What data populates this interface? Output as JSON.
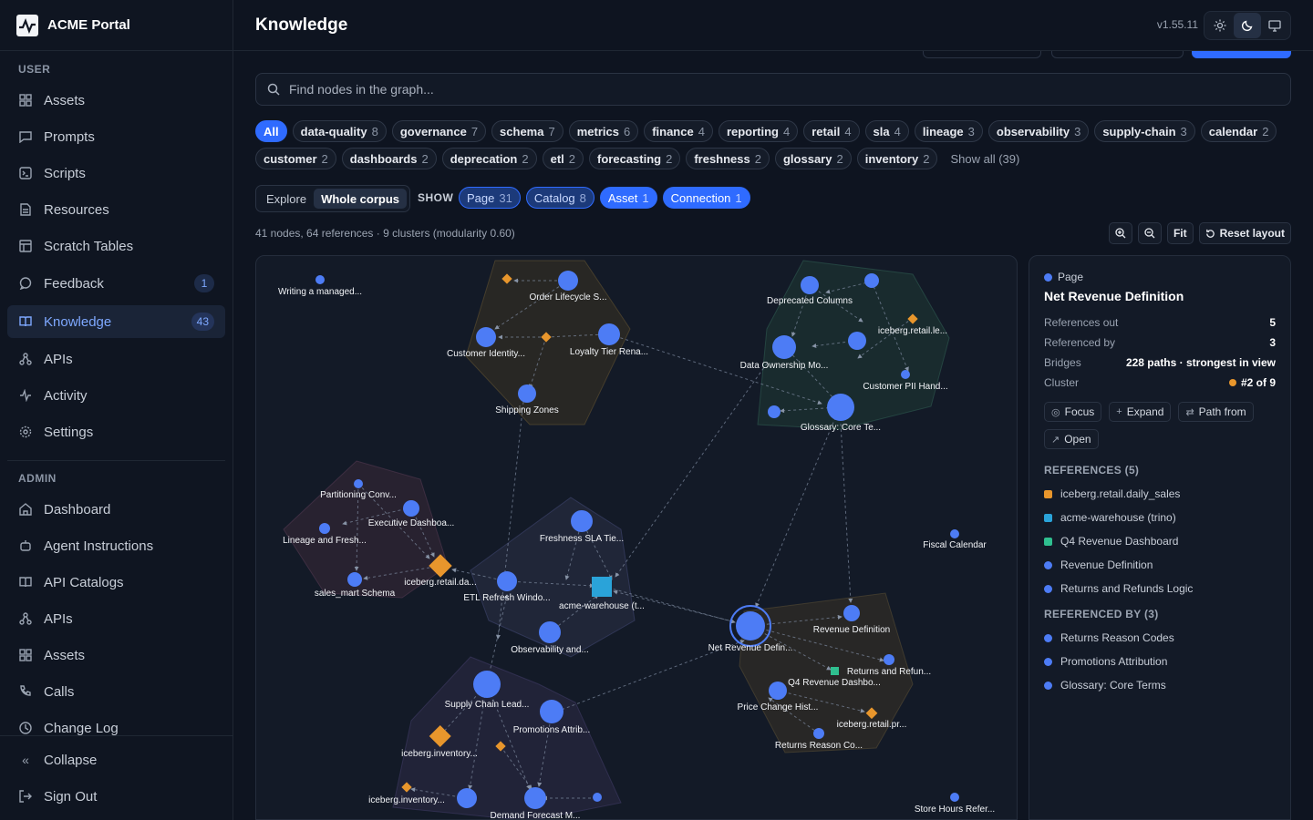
{
  "brand": {
    "name": "ACME Portal"
  },
  "sidebar": {
    "user_label": "USER",
    "admin_label": "ADMIN",
    "user_items": [
      {
        "label": "Assets",
        "icon": "grid-icon"
      },
      {
        "label": "Prompts",
        "icon": "chat-icon"
      },
      {
        "label": "Scripts",
        "icon": "code-icon"
      },
      {
        "label": "Resources",
        "icon": "document-icon"
      },
      {
        "label": "Scratch Tables",
        "icon": "table-icon"
      },
      {
        "label": "Feedback",
        "icon": "message-icon",
        "badge": "1"
      },
      {
        "label": "Knowledge",
        "icon": "book-icon",
        "badge": "43",
        "active": true
      },
      {
        "label": "APIs",
        "icon": "network-icon"
      },
      {
        "label": "Activity",
        "icon": "pulse-icon"
      },
      {
        "label": "Settings",
        "icon": "gear-icon"
      }
    ],
    "admin_items": [
      {
        "label": "Dashboard",
        "icon": "home-icon"
      },
      {
        "label": "Agent Instructions",
        "icon": "bot-icon"
      },
      {
        "label": "API Catalogs",
        "icon": "book-icon"
      },
      {
        "label": "APIs",
        "icon": "network-icon"
      },
      {
        "label": "Assets",
        "icon": "grid-icon"
      },
      {
        "label": "Calls",
        "icon": "phone-icon"
      },
      {
        "label": "Change Log",
        "icon": "clock-icon"
      }
    ],
    "collapse_label": "Collapse",
    "signout_label": "Sign Out"
  },
  "header": {
    "title": "Knowledge",
    "version": "v1.55.11"
  },
  "search": {
    "placeholder": "Find nodes in the graph..."
  },
  "tags": {
    "row1": [
      {
        "label": "All",
        "count": "",
        "active": true
      },
      {
        "label": "data-quality",
        "count": "8"
      },
      {
        "label": "governance",
        "count": "7"
      },
      {
        "label": "schema",
        "count": "7"
      },
      {
        "label": "metrics",
        "count": "6"
      },
      {
        "label": "finance",
        "count": "4"
      },
      {
        "label": "reporting",
        "count": "4"
      },
      {
        "label": "retail",
        "count": "4"
      },
      {
        "label": "sla",
        "count": "4"
      },
      {
        "label": "lineage",
        "count": "3"
      },
      {
        "label": "observability",
        "count": "3"
      },
      {
        "label": "supply-chain",
        "count": "3"
      },
      {
        "label": "calendar",
        "count": "2"
      }
    ],
    "row2": [
      {
        "label": "customer",
        "count": "2"
      },
      {
        "label": "dashboards",
        "count": "2"
      },
      {
        "label": "deprecation",
        "count": "2"
      },
      {
        "label": "etl",
        "count": "2"
      },
      {
        "label": "forecasting",
        "count": "2"
      },
      {
        "label": "freshness",
        "count": "2"
      },
      {
        "label": "glossary",
        "count": "2"
      },
      {
        "label": "inventory",
        "count": "2"
      }
    ],
    "show_all": "Show all (39)"
  },
  "mode": {
    "explore": "Explore",
    "whole": "Whole corpus",
    "show_label": "SHOW"
  },
  "types": [
    {
      "label": "Page",
      "count": "31",
      "solid": false
    },
    {
      "label": "Catalog",
      "count": "8",
      "solid": false
    },
    {
      "label": "Asset",
      "count": "1",
      "solid": true
    },
    {
      "label": "Connection",
      "count": "1",
      "solid": true
    }
  ],
  "stats": "41 nodes, 64 references · 9 clusters (modularity 0.60)",
  "tools": {
    "fit": "Fit",
    "reset": "Reset layout"
  },
  "graph": {
    "labels": [
      "Writing a managed...",
      "Order Lifecycle S...",
      "Customer Identity...",
      "Loyalty Tier Rena...",
      "Shipping Zones",
      "Deprecated Columns",
      "iceberg.retail.le...",
      "Data Ownership Mo...",
      "Customer PII Hand...",
      "Glossary: Core Te...",
      "Partitioning Conv...",
      "Executive Dashboa...",
      "Lineage and Fresh...",
      "iceberg.retail.da...",
      "sales_mart Schema",
      "Freshness SLA Tie...",
      "ETL Refresh Windo...",
      "acme-warehouse (t...",
      "Observability and...",
      "Fiscal Calendar",
      "Net Revenue Defin...",
      "Revenue Definition",
      "Returns and Refun...",
      "Q4 Revenue Dashbo...",
      "Price Change Hist...",
      "iceberg.retail.pr...",
      "Returns Reason Co...",
      "Supply Chain Lead...",
      "Promotions Attrib...",
      "iceberg.inventory...",
      "iceberg.inventory...",
      "Demand Forecast M...",
      "Store Hours Refer..."
    ]
  },
  "panel": {
    "kind": "Page",
    "title": "Net Revenue Definition",
    "refs_out_label": "References out",
    "refs_out": "5",
    "ref_by_label": "Referenced by",
    "ref_by": "3",
    "bridges_label": "Bridges",
    "bridges": "228 paths · strongest in view",
    "cluster_label": "Cluster",
    "cluster": "#2 of 9",
    "actions": {
      "focus": "Focus",
      "expand": "Expand",
      "path": "Path from",
      "open": "Open"
    },
    "references_title": "REFERENCES (5)",
    "references": [
      {
        "label": "iceberg.retail.daily_sales",
        "color": "#e8962c",
        "shape": "square"
      },
      {
        "label": "acme-warehouse (trino)",
        "color": "#2aa3d9",
        "shape": "square"
      },
      {
        "label": "Q4 Revenue Dashboard",
        "color": "#2fbf8f",
        "shape": "square"
      },
      {
        "label": "Revenue Definition",
        "color": "#4d7cf5",
        "shape": "dot"
      },
      {
        "label": "Returns and Refunds Logic",
        "color": "#4d7cf5",
        "shape": "dot"
      }
    ],
    "referenced_by_title": "REFERENCED BY (3)",
    "referenced_by": [
      {
        "label": "Returns Reason Codes",
        "color": "#4d7cf5",
        "shape": "dot"
      },
      {
        "label": "Promotions Attribution",
        "color": "#4d7cf5",
        "shape": "dot"
      },
      {
        "label": "Glossary: Core Terms",
        "color": "#4d7cf5",
        "shape": "dot"
      }
    ]
  }
}
